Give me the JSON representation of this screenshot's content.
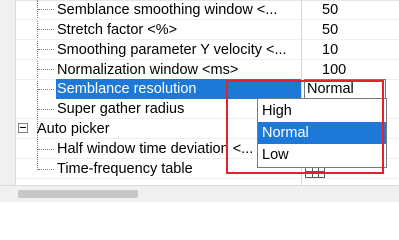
{
  "properties": [
    {
      "name": "Semblance smoothing window <...",
      "value": "50"
    },
    {
      "name": "Stretch factor <%>",
      "value": "50"
    },
    {
      "name": "Smoothing parameter Y velocity <...",
      "value": "10"
    },
    {
      "name": "Normalization window <ms>",
      "value": "100"
    },
    {
      "name": "Semblance resolution",
      "value": "Normal"
    },
    {
      "name": "Super gather radius",
      "value": ""
    }
  ],
  "group": {
    "label": "Auto picker"
  },
  "group_children": [
    {
      "name": "Half window time deviation <...",
      "value": ""
    },
    {
      "name": "Time-frequency table",
      "value": "table-icon"
    }
  ],
  "dropdown": {
    "options": [
      "High",
      "Normal",
      "Low"
    ],
    "selected": "Normal"
  },
  "colors": {
    "selection": "#1e78d7",
    "highlight_box": "#e8202d"
  }
}
